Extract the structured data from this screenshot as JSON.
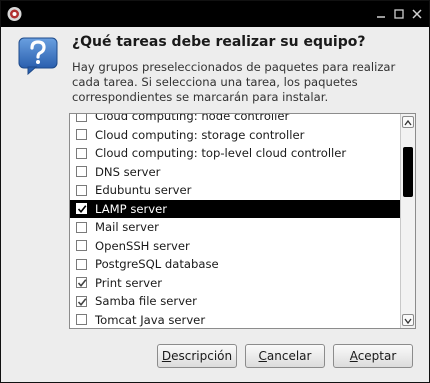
{
  "dialog": {
    "question": "¿Qué tareas debe realizar su equipo?",
    "description": "Hay grupos preseleccionados de paquetes para realizar cada tarea. Si selecciona una tarea, los paquetes correspondientes se marcarán para instalar."
  },
  "tasks": [
    {
      "label": "Cloud computing: node controller",
      "checked": false,
      "selected": false
    },
    {
      "label": "Cloud computing: storage controller",
      "checked": false,
      "selected": false
    },
    {
      "label": "Cloud computing: top-level cloud controller",
      "checked": false,
      "selected": false
    },
    {
      "label": "DNS server",
      "checked": false,
      "selected": false
    },
    {
      "label": "Edubuntu server",
      "checked": false,
      "selected": false
    },
    {
      "label": "LAMP server",
      "checked": true,
      "selected": true
    },
    {
      "label": "Mail server",
      "checked": false,
      "selected": false
    },
    {
      "label": "OpenSSH server",
      "checked": false,
      "selected": false
    },
    {
      "label": "PostgreSQL database",
      "checked": false,
      "selected": false
    },
    {
      "label": "Print server",
      "checked": true,
      "selected": false
    },
    {
      "label": "Samba file server",
      "checked": true,
      "selected": false
    },
    {
      "label": "Tomcat Java server",
      "checked": false,
      "selected": false
    }
  ],
  "buttons": {
    "description": {
      "mnemonic": "D",
      "rest": "escripción"
    },
    "cancel": {
      "mnemonic": "C",
      "rest": "ancelar"
    },
    "accept": {
      "mnemonic": "A",
      "rest": "ceptar"
    }
  },
  "icons": {
    "app": "app-logo-icon",
    "help": "question-icon",
    "minimize": "minimize-icon",
    "maximize": "maximize-icon",
    "close": "close-icon"
  }
}
